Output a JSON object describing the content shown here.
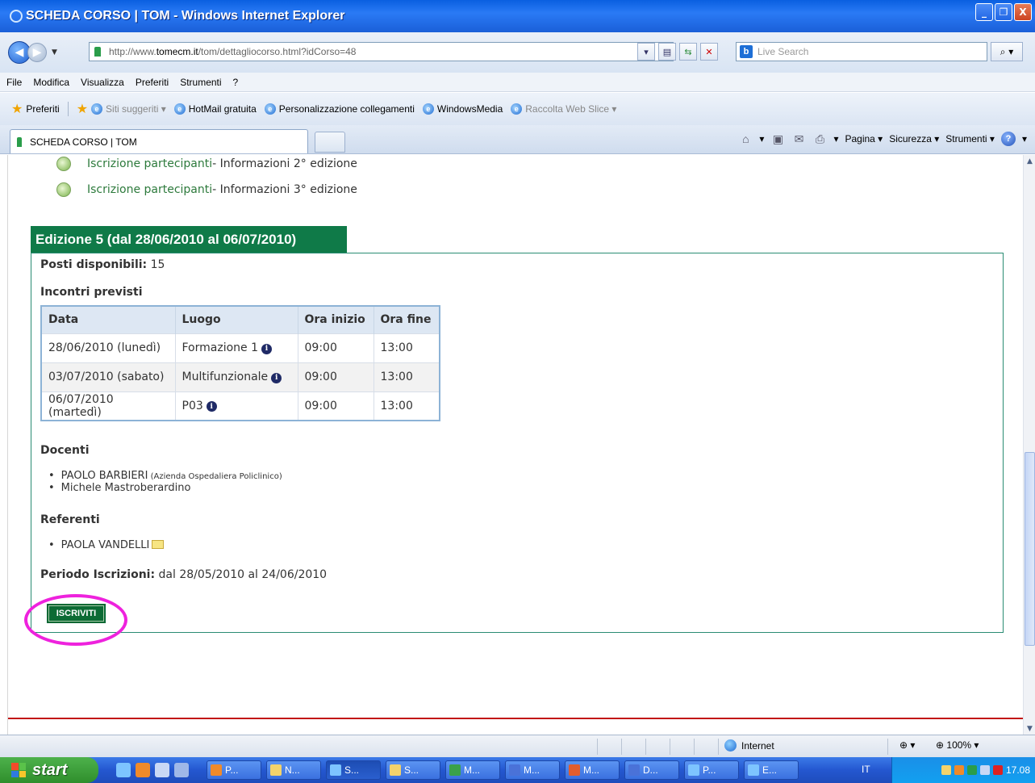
{
  "window": {
    "title": "SCHEDA CORSO | TOM - Windows Internet Explorer",
    "buttons": [
      "_",
      "❐",
      "X"
    ]
  },
  "address": {
    "url_prefix": "http://www.",
    "url_domain": "tomecm.it",
    "url_rest": "/tom/dettagliocorso.html?idCorso=48",
    "search_placeholder": "Live Search"
  },
  "menu": [
    "File",
    "Modifica",
    "Visualizza",
    "Preferiti",
    "Strumenti",
    "?"
  ],
  "favorites": {
    "label": "Preferiti",
    "items": [
      {
        "label": "Siti suggeriti ▾",
        "dim": true
      },
      {
        "label": "HotMail gratuita",
        "dim": false
      },
      {
        "label": "Personalizzazione collegamenti",
        "dim": false
      },
      {
        "label": "WindowsMedia",
        "dim": false
      },
      {
        "label": "Raccolta Web Slice ▾",
        "dim": true
      }
    ]
  },
  "tab": {
    "label": "SCHEDA CORSO | TOM",
    "commands": [
      "Pagina ▾",
      "Sicurezza ▾",
      "Strumenti ▾"
    ]
  },
  "content": {
    "links": [
      {
        "link": "Iscrizione partecipanti",
        "rest": " - Informazioni 2° edizione"
      },
      {
        "link": "Iscrizione partecipanti",
        "rest": " - Informazioni 3° edizione"
      }
    ],
    "edition_title": "Edizione 5 (dal 28/06/2010 al 06/07/2010)",
    "posti_label": "Posti disponibili:",
    "posti_value": " 15",
    "incontri_label": "Incontri previsti",
    "table": {
      "headers": [
        "Data",
        "Luogo",
        "Ora inizio",
        "Ora fine"
      ],
      "rows": [
        {
          "data": "28/06/2010 (lunedì)",
          "luogo": "Formazione 1",
          "inizio": "09:00",
          "fine": "13:00"
        },
        {
          "data": "03/07/2010 (sabato)",
          "luogo": "Multifunzionale",
          "inizio": "09:00",
          "fine": "13:00"
        },
        {
          "data": "06/07/2010 (martedì)",
          "luogo": "P03",
          "inizio": "09:00",
          "fine": "13:00"
        }
      ]
    },
    "docenti_label": "Docenti",
    "docenti": [
      {
        "name": "PAOLO BARBIERI",
        "org": " (Azienda Ospedaliera Policlinico)"
      },
      {
        "name": "Michele Mastroberardino",
        "org": ""
      }
    ],
    "referenti_label": "Referenti",
    "referente": "PAOLA VANDELLI",
    "periodo_label": "Periodo Iscrizioni:",
    "periodo_value": " dal 28/05/2010 al 24/06/2010",
    "button": "ISCRIVITI"
  },
  "status": {
    "zone": "Internet",
    "zoom": "100%"
  },
  "taskbar": {
    "start": "start",
    "buttons": [
      {
        "label": "P...",
        "color": "#f08a2a"
      },
      {
        "label": "N...",
        "color": "#f4d36b"
      },
      {
        "label": "S...",
        "color": "#7dc4ff",
        "active": true
      },
      {
        "label": "S...",
        "color": "#f4d36b"
      },
      {
        "label": "M...",
        "color": "#3aa14a"
      },
      {
        "label": "M...",
        "color": "#4a72d8"
      },
      {
        "label": "M...",
        "color": "#e25d2d"
      },
      {
        "label": "D...",
        "color": "#4a72d8"
      },
      {
        "label": "P...",
        "color": "#7dc4ff"
      },
      {
        "label": "E...",
        "color": "#7dc4ff"
      }
    ],
    "lang": "IT",
    "clock": "17.08"
  }
}
